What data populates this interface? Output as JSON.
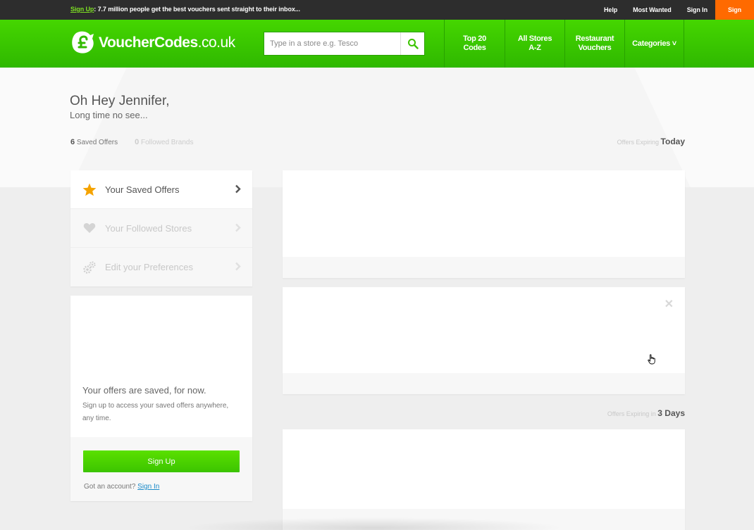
{
  "topbar": {
    "promo_link": "Sign Up",
    "promo_text": ": 7.7 million people get the best vouchers sent straight to their inbox...",
    "links": [
      "Help",
      "Most Wanted",
      "Sign In"
    ],
    "signup_label": "Sign Up"
  },
  "header": {
    "logo_bold": "VoucherCodes",
    "logo_light": ".co.uk",
    "search_placeholder": "Type in a store e.g. Tesco",
    "nav": [
      {
        "line1": "Top 20",
        "line2": "Codes"
      },
      {
        "line1": "All Stores",
        "line2": "A-Z"
      },
      {
        "line1": "Restaurant",
        "line2": "Vouchers"
      },
      {
        "line1": "Categories ˅",
        "line2": ""
      }
    ]
  },
  "hero": {
    "greeting": "Oh Hey Jennifer,",
    "subgreeting": "Long time no see...",
    "saved_count": "6",
    "saved_label": "Saved Offers",
    "followed_count": "0",
    "followed_label": "Followed Brands"
  },
  "expiring": [
    {
      "prefix": "Offers Expiring",
      "value": "Today"
    },
    {
      "prefix": "Offers Expiring in",
      "value": "3 Days"
    }
  ],
  "menu": {
    "items": [
      {
        "label": "Your Saved Offers",
        "icon": "star-icon"
      },
      {
        "label": "Your Followed Stores",
        "icon": "heart-icon"
      },
      {
        "label": "Edit your Preferences",
        "icon": "gears-icon"
      }
    ]
  },
  "saved_card": {
    "title": "Your offers are saved, for now.",
    "body": "Sign up to access your saved offers anywhere, any time.",
    "button": "Sign Up",
    "account_text": "Got an account?",
    "signin_link": "Sign In"
  },
  "colors": {
    "brand_green": "#3cc400",
    "accent_orange": "#ff6a00",
    "star": "#f5a300"
  }
}
